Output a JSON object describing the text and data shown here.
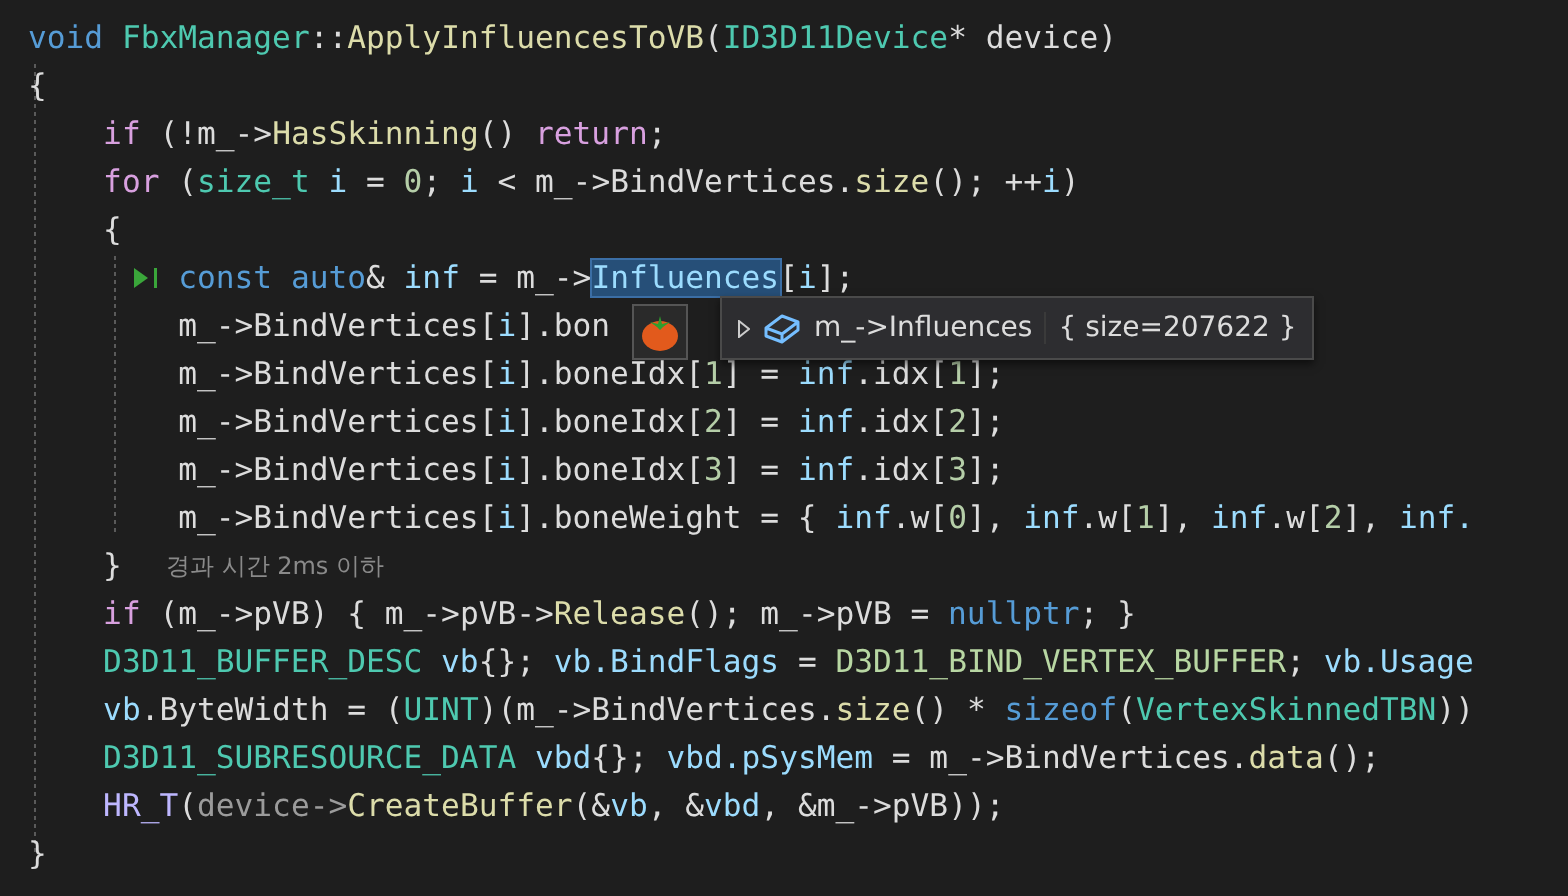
{
  "editor": {
    "lines": [
      {
        "tokens": [
          {
            "kind": "keyword",
            "text": "void"
          },
          {
            "kind": "type",
            "text": " FbxManager"
          },
          {
            "kind": "plain",
            "text": "::"
          },
          {
            "kind": "function",
            "text": "ApplyInfluencesToVB"
          },
          {
            "kind": "plain",
            "text": "("
          },
          {
            "kind": "type",
            "text": "ID3D11Device"
          },
          {
            "kind": "plain",
            "text": "* device)"
          }
        ]
      },
      {
        "tokens": [
          {
            "kind": "plain",
            "text": "{"
          }
        ]
      },
      {
        "tokens": [
          {
            "kind": "control",
            "text": "    if"
          },
          {
            "kind": "plain",
            "text": " (!m_->"
          },
          {
            "kind": "function",
            "text": "HasSkinning"
          },
          {
            "kind": "plain",
            "text": "() "
          },
          {
            "kind": "control",
            "text": "return"
          },
          {
            "kind": "plain",
            "text": ";"
          }
        ]
      },
      {
        "tokens": [
          {
            "kind": "control",
            "text": "    for"
          },
          {
            "kind": "plain",
            "text": " ("
          },
          {
            "kind": "type",
            "text": "size_t"
          },
          {
            "kind": "variable",
            "text": " i"
          },
          {
            "kind": "plain",
            "text": " = "
          },
          {
            "kind": "number",
            "text": "0"
          },
          {
            "kind": "plain",
            "text": "; "
          },
          {
            "kind": "variable",
            "text": "i"
          },
          {
            "kind": "plain",
            "text": " < m_->BindVertices."
          },
          {
            "kind": "function",
            "text": "size"
          },
          {
            "kind": "plain",
            "text": "(); ++"
          },
          {
            "kind": "variable",
            "text": "i"
          },
          {
            "kind": "plain",
            "text": ")"
          }
        ]
      },
      {
        "tokens": [
          {
            "kind": "plain",
            "text": "    {"
          }
        ]
      },
      {
        "run_to_cursor": true,
        "tokens": [
          {
            "kind": "keyword",
            "text": "        const"
          },
          {
            "kind": "keyword",
            "text": " auto"
          },
          {
            "kind": "plain",
            "text": "& "
          },
          {
            "kind": "variable",
            "text": "inf"
          },
          {
            "kind": "plain",
            "text": " = m_->"
          },
          {
            "kind": "selection",
            "text": "Influences"
          },
          {
            "kind": "plain",
            "text": "["
          },
          {
            "kind": "variable",
            "text": "i"
          },
          {
            "kind": "plain",
            "text": "];"
          }
        ]
      },
      {
        "tokens": [
          {
            "kind": "plain",
            "text": "        m_->BindVertices["
          },
          {
            "kind": "variable",
            "text": "i"
          },
          {
            "kind": "plain",
            "text": "].bon"
          }
        ]
      },
      {
        "tokens": [
          {
            "kind": "plain",
            "text": "        m_->BindVertices["
          },
          {
            "kind": "variable",
            "text": "i"
          },
          {
            "kind": "plain",
            "text": "].boneIdx["
          },
          {
            "kind": "number",
            "text": "1"
          },
          {
            "kind": "plain",
            "text": "] = "
          },
          {
            "kind": "variable",
            "text": "inf"
          },
          {
            "kind": "plain",
            "text": ".idx["
          },
          {
            "kind": "number",
            "text": "1"
          },
          {
            "kind": "plain",
            "text": "];"
          }
        ]
      },
      {
        "tokens": [
          {
            "kind": "plain",
            "text": "        m_->BindVertices["
          },
          {
            "kind": "variable",
            "text": "i"
          },
          {
            "kind": "plain",
            "text": "].boneIdx["
          },
          {
            "kind": "number",
            "text": "2"
          },
          {
            "kind": "plain",
            "text": "] = "
          },
          {
            "kind": "variable",
            "text": "inf"
          },
          {
            "kind": "plain",
            "text": ".idx["
          },
          {
            "kind": "number",
            "text": "2"
          },
          {
            "kind": "plain",
            "text": "];"
          }
        ]
      },
      {
        "tokens": [
          {
            "kind": "plain",
            "text": "        m_->BindVertices["
          },
          {
            "kind": "variable",
            "text": "i"
          },
          {
            "kind": "plain",
            "text": "].boneIdx["
          },
          {
            "kind": "number",
            "text": "3"
          },
          {
            "kind": "plain",
            "text": "] = "
          },
          {
            "kind": "variable",
            "text": "inf"
          },
          {
            "kind": "plain",
            "text": ".idx["
          },
          {
            "kind": "number",
            "text": "3"
          },
          {
            "kind": "plain",
            "text": "];"
          }
        ]
      },
      {
        "tokens": [
          {
            "kind": "plain",
            "text": "        m_->BindVertices["
          },
          {
            "kind": "variable",
            "text": "i"
          },
          {
            "kind": "plain",
            "text": "].boneWeight = { "
          },
          {
            "kind": "variable",
            "text": "inf"
          },
          {
            "kind": "plain",
            "text": ".w["
          },
          {
            "kind": "number",
            "text": "0"
          },
          {
            "kind": "plain",
            "text": "], "
          },
          {
            "kind": "variable",
            "text": "inf"
          },
          {
            "kind": "plain",
            "text": ".w["
          },
          {
            "kind": "number",
            "text": "1"
          },
          {
            "kind": "plain",
            "text": "], "
          },
          {
            "kind": "variable",
            "text": "inf"
          },
          {
            "kind": "plain",
            "text": ".w["
          },
          {
            "kind": "number",
            "text": "2"
          },
          {
            "kind": "plain",
            "text": "], "
          },
          {
            "kind": "variable",
            "text": "inf."
          }
        ]
      },
      {
        "hint": "경과 시간 2ms 이하",
        "tokens": [
          {
            "kind": "plain",
            "text": "    }"
          }
        ]
      },
      {
        "tokens": [
          {
            "kind": "control",
            "text": "    if"
          },
          {
            "kind": "plain",
            "text": " (m_->pVB) { m_->pVB->"
          },
          {
            "kind": "function",
            "text": "Release"
          },
          {
            "kind": "plain",
            "text": "(); m_->pVB = "
          },
          {
            "kind": "keyword",
            "text": "nullptr"
          },
          {
            "kind": "plain",
            "text": "; }"
          }
        ]
      },
      {
        "tokens": [
          {
            "kind": "type",
            "text": "    D3D11_BUFFER_DESC"
          },
          {
            "kind": "variable",
            "text": " vb"
          },
          {
            "kind": "plain",
            "text": "{}; "
          },
          {
            "kind": "variable",
            "text": "vb.BindFlags"
          },
          {
            "kind": "plain",
            "text": " = "
          },
          {
            "kind": "enum",
            "text": "D3D11_BIND_VERTEX_BUFFER"
          },
          {
            "kind": "plain",
            "text": "; "
          },
          {
            "kind": "variable",
            "text": "vb.Usage"
          }
        ]
      },
      {
        "tokens": [
          {
            "kind": "variable",
            "text": "    vb"
          },
          {
            "kind": "plain",
            "text": ".ByteWidth = ("
          },
          {
            "kind": "type",
            "text": "UINT"
          },
          {
            "kind": "plain",
            "text": ")(m_->BindVertices."
          },
          {
            "kind": "function",
            "text": "size"
          },
          {
            "kind": "plain",
            "text": "() * "
          },
          {
            "kind": "keyword",
            "text": "sizeof"
          },
          {
            "kind": "plain",
            "text": "("
          },
          {
            "kind": "type",
            "text": "VertexSkinnedTBN"
          },
          {
            "kind": "plain",
            "text": "))"
          }
        ]
      },
      {
        "tokens": [
          {
            "kind": "type",
            "text": "    D3D11_SUBRESOURCE_DATA"
          },
          {
            "kind": "variable",
            "text": " vbd"
          },
          {
            "kind": "plain",
            "text": "{}; "
          },
          {
            "kind": "variable",
            "text": "vbd.pSysMem"
          },
          {
            "kind": "plain",
            "text": " = m_->BindVertices."
          },
          {
            "kind": "function",
            "text": "data"
          },
          {
            "kind": "plain",
            "text": "();"
          }
        ]
      },
      {
        "tokens": [
          {
            "kind": "macro",
            "text": "    HR_T"
          },
          {
            "kind": "plain",
            "text": "("
          },
          {
            "kind": "dim",
            "text": "device->"
          },
          {
            "kind": "function",
            "text": "CreateBuffer"
          },
          {
            "kind": "plain",
            "text": "(&"
          },
          {
            "kind": "variable",
            "text": "vb"
          },
          {
            "kind": "plain",
            "text": ", &"
          },
          {
            "kind": "variable",
            "text": "vbd"
          },
          {
            "kind": "plain",
            "text": ", &m_->pVB));"
          }
        ]
      },
      {
        "tokens": [
          {
            "kind": "plain",
            "text": "}"
          }
        ]
      }
    ]
  },
  "datatip": {
    "expression": "m_->Influences",
    "value": "{ size=207622 }"
  }
}
